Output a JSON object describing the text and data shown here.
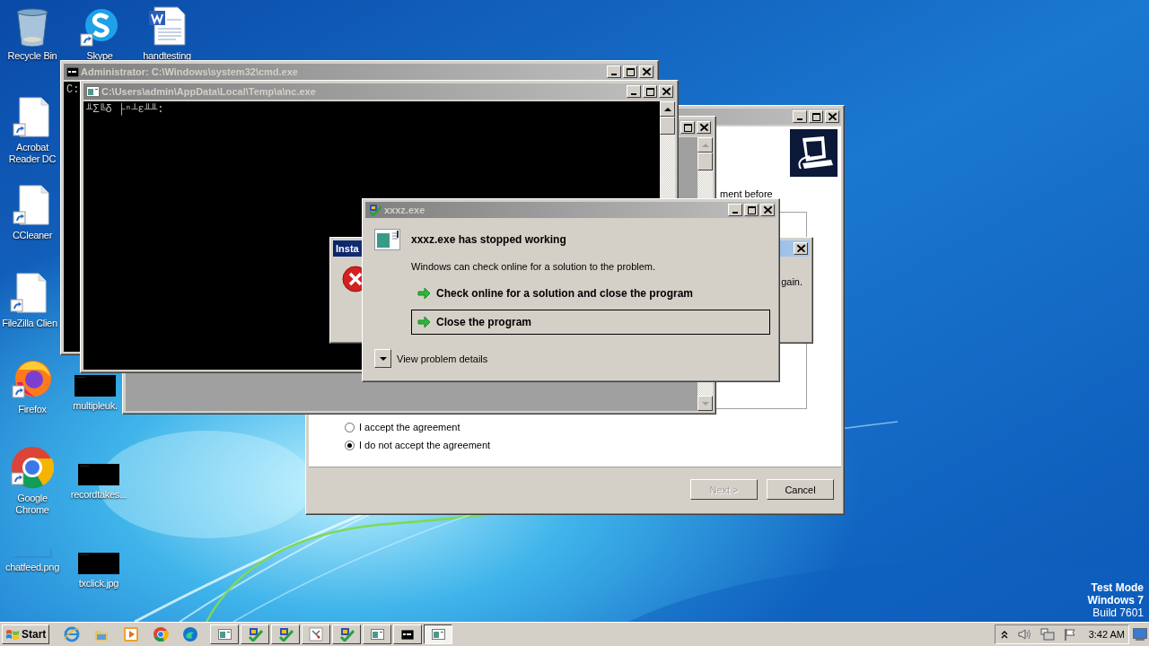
{
  "desktop_icons": [
    {
      "label": "Recycle Bin",
      "kind": "recycle"
    },
    {
      "label": "Skype",
      "kind": "app"
    },
    {
      "label": "handtesting",
      "kind": "word"
    },
    {
      "label": "Acrobat Reader DC",
      "kind": "doc"
    },
    {
      "label": "CCleaner",
      "kind": "doc"
    },
    {
      "label": "FileZilla Clien",
      "kind": "doc"
    },
    {
      "label": "Firefox",
      "kind": "firefox"
    },
    {
      "label": "multipleuk.",
      "kind": "thumb"
    },
    {
      "label": "Google Chrome",
      "kind": "chrome"
    },
    {
      "label": "recordtakes...",
      "kind": "thumb"
    },
    {
      "label": "chatfeed.png",
      "kind": "blank"
    },
    {
      "label": "txclick.jpg",
      "kind": "thumb"
    }
  ],
  "installer": {
    "partial_text": "ment before",
    "options": [
      {
        "label": "I accept the agreement",
        "selected": false
      },
      {
        "label": "I do not accept the agreement",
        "selected": true
      }
    ],
    "buttons": [
      {
        "label": "Next >",
        "disabled": true
      },
      {
        "label": "Cancel",
        "disabled": false
      }
    ]
  },
  "cmd_window": {
    "title": "Administrator: C:\\Windows\\system32\\cmd.exe",
    "text": "C:"
  },
  "nc_window": {
    "title": "C:\\Users\\admin\\AppData\\Local\\Temp\\a\\nc.exe",
    "text": "╨Σ╚δ ├ⁿ┴ε╨╨:"
  },
  "message_box": {
    "title": "Insta",
    "text": "gain."
  },
  "error_dialog": {
    "title": "xxxz.exe",
    "heading": "xxxz.exe has stopped working",
    "body": "Windows can check online for a solution to the problem.",
    "actions": [
      {
        "label": "Check online for a solution and close the program",
        "selected": false
      },
      {
        "label": "Close the program",
        "selected": true
      }
    ],
    "details": "View problem details"
  },
  "watermark": [
    "Test Mode",
    "Windows 7",
    "Build 7601"
  ],
  "taskbar": {
    "start": "Start",
    "quick_launch": [
      {
        "kind": "ie"
      },
      {
        "kind": "folder"
      },
      {
        "kind": "media"
      },
      {
        "kind": "chrome"
      },
      {
        "kind": "edge"
      }
    ],
    "tasks": [
      {
        "kind": "window",
        "selected": false
      },
      {
        "kind": "setup",
        "selected": false
      },
      {
        "kind": "setup",
        "selected": false
      },
      {
        "kind": "tool",
        "selected": false
      },
      {
        "kind": "setup",
        "selected": false
      },
      {
        "kind": "window",
        "selected": false
      },
      {
        "kind": "console",
        "selected": false
      },
      {
        "kind": "window",
        "selected": true
      }
    ],
    "clock": "3:42 AM"
  }
}
